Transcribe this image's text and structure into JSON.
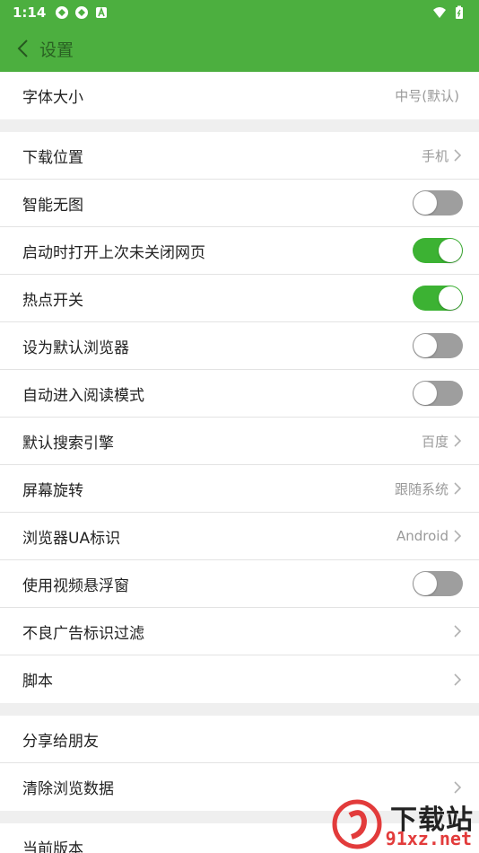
{
  "status": {
    "time": "1:14"
  },
  "appbar": {
    "title": "设置"
  },
  "groups": [
    {
      "rows": [
        {
          "label": "字体大小",
          "value": "中号(默认)",
          "type": "value"
        }
      ]
    },
    {
      "rows": [
        {
          "label": "下载位置",
          "value": "手机",
          "type": "nav"
        },
        {
          "label": "智能无图",
          "type": "toggle",
          "on": false
        },
        {
          "label": "启动时打开上次未关闭网页",
          "type": "toggle",
          "on": true
        },
        {
          "label": "热点开关",
          "type": "toggle",
          "on": true
        },
        {
          "label": "设为默认浏览器",
          "type": "toggle",
          "on": false
        },
        {
          "label": "自动进入阅读模式",
          "type": "toggle",
          "on": false
        },
        {
          "label": "默认搜索引擎",
          "value": "百度",
          "type": "nav"
        },
        {
          "label": "屏幕旋转",
          "value": "跟随系统",
          "type": "nav"
        },
        {
          "label": "浏览器UA标识",
          "value": "Android",
          "type": "nav"
        },
        {
          "label": "使用视频悬浮窗",
          "type": "toggle",
          "on": false
        },
        {
          "label": "不良广告标识过滤",
          "value": "",
          "type": "nav"
        },
        {
          "label": "脚本",
          "value": "",
          "type": "nav"
        }
      ]
    },
    {
      "rows": [
        {
          "label": "分享给朋友",
          "type": "plain"
        },
        {
          "label": "清除浏览数据",
          "value": "",
          "type": "nav"
        }
      ]
    },
    {
      "rows": [
        {
          "label": "当前版本",
          "type": "plain"
        }
      ]
    }
  ],
  "watermark": {
    "text": "下载站",
    "sub": "91xz.net"
  },
  "colors": {
    "accent": "#4caf3f",
    "toggle_on": "#3cb233",
    "toggle_off": "#9e9e9e"
  }
}
